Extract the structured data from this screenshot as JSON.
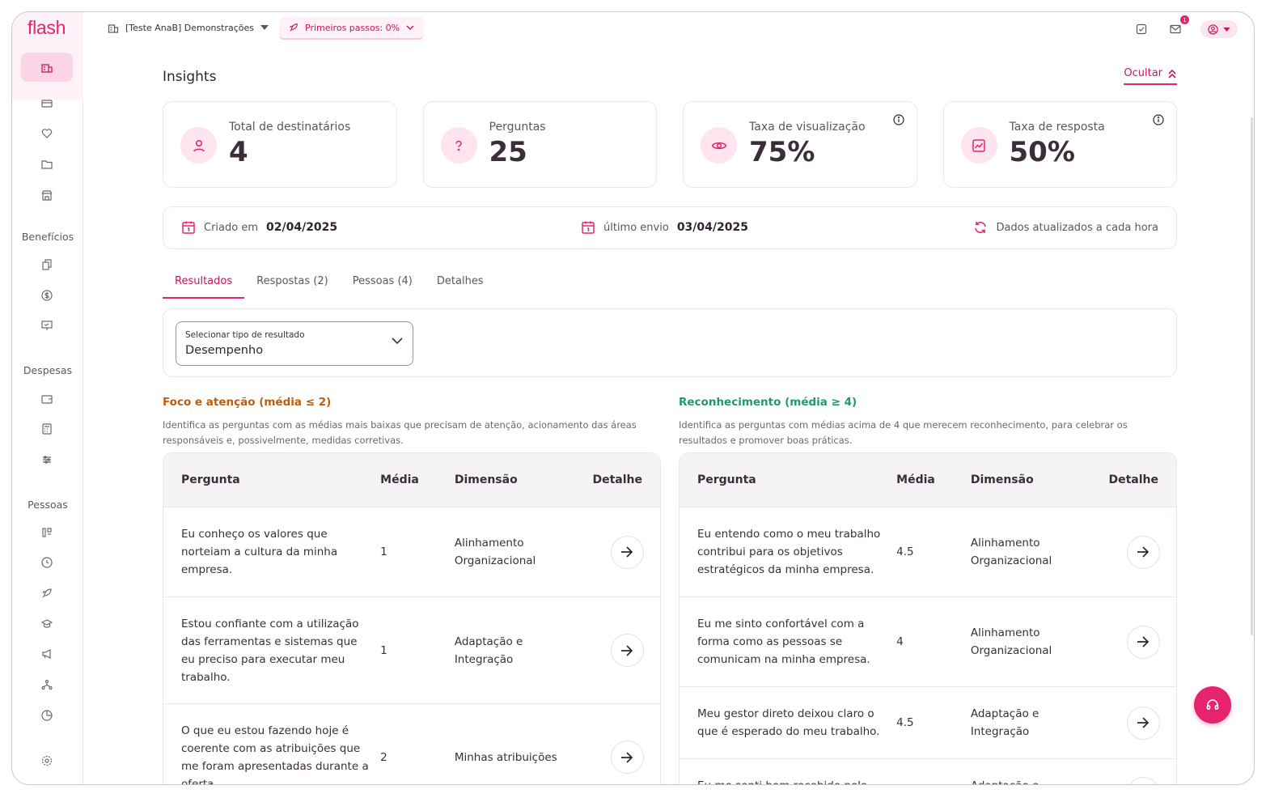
{
  "app": {
    "logo": "flash"
  },
  "sidebar": {
    "sections": [
      {
        "label": "Benefícios"
      },
      {
        "label": "Despesas"
      },
      {
        "label": "Pessoas"
      }
    ]
  },
  "topbar": {
    "company": "[Teste AnaB] Demonstrações",
    "first_steps": "Primeiros passos: 0%",
    "mail_badge": "1"
  },
  "page": {
    "title": "Insights",
    "hide_label": "Ocultar"
  },
  "stats": [
    {
      "label": "Total de destinatários",
      "value": "4",
      "icon": "person-icon"
    },
    {
      "label": "Perguntas",
      "value": "25",
      "icon": "question-icon"
    },
    {
      "label": "Taxa de visualização",
      "value": "75%",
      "icon": "eye-icon"
    },
    {
      "label": "Taxa de resposta",
      "value": "50%",
      "icon": "chart-icon"
    }
  ],
  "dates": {
    "created_label": "Criado em",
    "created_value": "02/04/2025",
    "last_sent_label": "último envio",
    "last_sent_value": "03/04/2025",
    "refresh_note": "Dados atualizados a cada hora"
  },
  "tabs": [
    {
      "label": "Resultados",
      "active": true
    },
    {
      "label": "Respostas (2)"
    },
    {
      "label": "Pessoas (4)"
    },
    {
      "label": "Detalhes"
    }
  ],
  "filter": {
    "label": "Selecionar tipo de resultado",
    "value": "Desempenho"
  },
  "focus": {
    "title": "Foco e atenção (média ≤ 2)",
    "description": "Identifica as perguntas com as médias mais baixas que precisam de atenção, acionamento das áreas responsáveis e, possivelmente, medidas corretivas.",
    "color": "#bf5b0c",
    "headers": [
      "Pergunta",
      "Média",
      "Dimensão",
      "Detalhe"
    ],
    "rows": [
      {
        "question": "Eu conheço os valores que norteiam a cultura da minha empresa.",
        "average": "1",
        "dimension": "Alinhamento Organizacional"
      },
      {
        "question": "Estou confiante com a utilização das ferramentas e sistemas que eu preciso para executar meu trabalho.",
        "average": "1",
        "dimension": "Adaptação e Integração"
      },
      {
        "question": "O que eu estou fazendo hoje é coerente com as atribuições que me foram apresentadas durante a oferta",
        "average": "2",
        "dimension": "Minhas atribuições"
      }
    ]
  },
  "recognition": {
    "title": "Reconhecimento (média ≥ 4)",
    "description": "Identifica as perguntas com médias acima de 4 que merecem reconhecimento, para celebrar os resultados e promover boas práticas.",
    "color": "#1f9a6c",
    "headers": [
      "Pergunta",
      "Média",
      "Dimensão",
      "Detalhe"
    ],
    "rows": [
      {
        "question": "Eu entendo como o meu trabalho contribui para os objetivos estratégicos da minha empresa.",
        "average": "4.5",
        "dimension": "Alinhamento Organizacional"
      },
      {
        "question": "Eu me sinto confortável com a forma como as pessoas se comunicam na minha empresa.",
        "average": "4",
        "dimension": "Alinhamento Organizacional"
      },
      {
        "question": "Meu gestor direto deixou claro o que é esperado do meu trabalho.",
        "average": "4.5",
        "dimension": "Adaptação e Integração"
      },
      {
        "question": "Eu me senti bem recebido pelo",
        "average": "",
        "dimension": "Adaptação e"
      }
    ]
  },
  "colors": {
    "accent": "#e5236f",
    "accent_light": "#fde4ef"
  }
}
